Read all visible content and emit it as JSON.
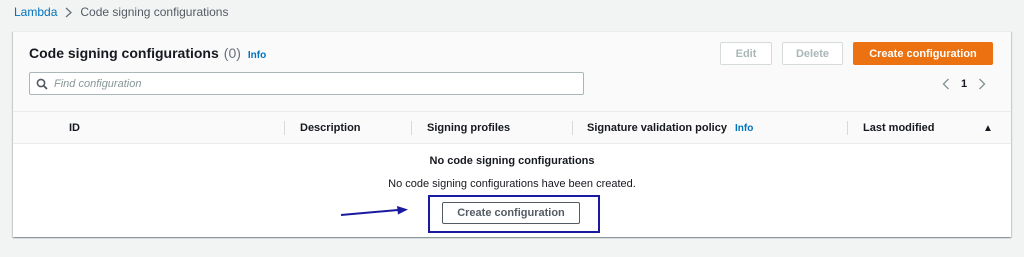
{
  "breadcrumb": {
    "root": "Lambda",
    "current": "Code signing configurations"
  },
  "panel": {
    "title": "Code signing configurations",
    "count": "(0)",
    "info": "Info",
    "buttons": {
      "edit": "Edit",
      "delete": "Delete",
      "create": "Create configuration"
    },
    "search": {
      "placeholder": "Find configuration",
      "value": ""
    },
    "pagination": {
      "page": "1"
    }
  },
  "table": {
    "columns": {
      "id": "ID",
      "description": "Description",
      "signing_profiles": "Signing profiles",
      "signature_policy": "Signature validation policy",
      "signature_policy_info": "Info",
      "last_modified": "Last modified"
    },
    "sort_indicator": "▲"
  },
  "empty_state": {
    "title": "No code signing configurations",
    "description": "No code signing configurations have been created.",
    "button": "Create configuration"
  },
  "colors": {
    "primary": "#ec7211",
    "link": "#0073bb",
    "annotation": "#1a1aa0"
  },
  "icons": {
    "breadcrumb_separator": "chevron-right-icon",
    "search": "search-icon",
    "pager_prev": "chevron-left-icon",
    "pager_next": "chevron-right-icon",
    "sort": "sort-ascending-icon",
    "annotation": "arrow-right-icon"
  }
}
